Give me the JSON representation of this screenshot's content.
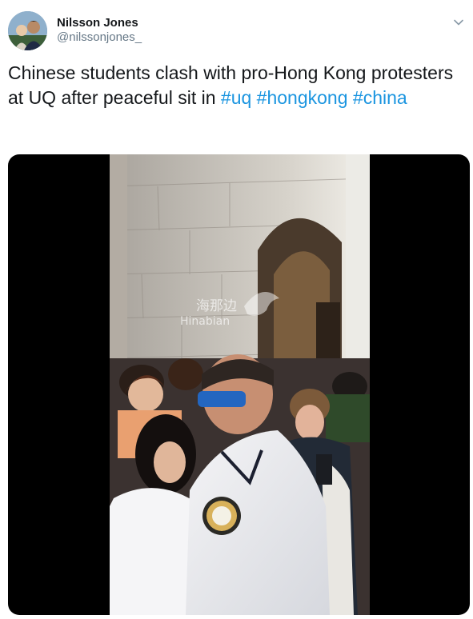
{
  "author": {
    "name": "Nilsson Jones",
    "handle": "@nilssonjones_"
  },
  "icons": {
    "more": "chevron-down-icon",
    "avatar": "avatar-photo"
  },
  "tweet": {
    "text_plain": "Chinese students clash with pro-Hong Kong protesters at UQ after peaceful sit in ",
    "hashtags": [
      "#uq",
      "#hongkong",
      "#china"
    ]
  },
  "media": {
    "watermark_cn": "海那边",
    "watermark_en": "Hinabian"
  },
  "colors": {
    "hashtag": "#1b95e0",
    "handle": "#657786",
    "text": "#14171a",
    "media_background": "#000000"
  }
}
